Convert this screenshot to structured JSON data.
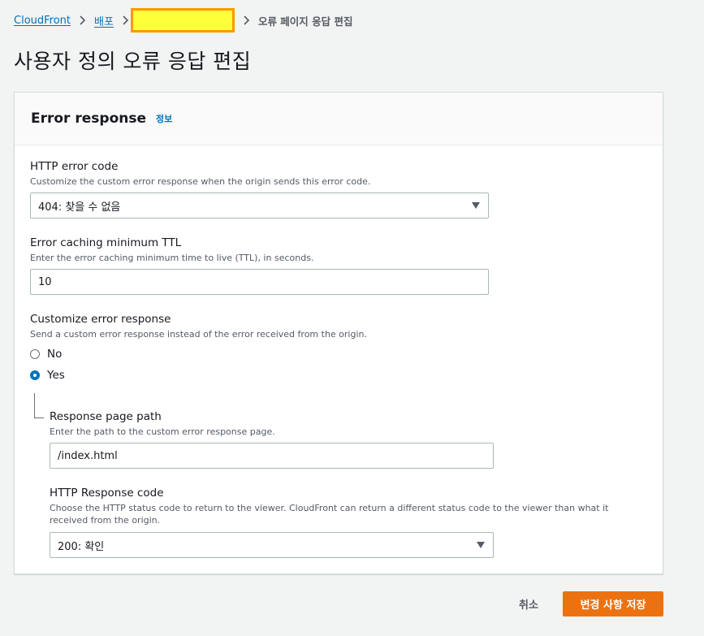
{
  "breadcrumb": {
    "items": [
      "CloudFront",
      "배포"
    ],
    "current": "오류 페이지 응답 편집"
  },
  "page": {
    "title": "사용자 정의 오류 응답 편집"
  },
  "panel": {
    "title": "Error response",
    "info": "정보"
  },
  "fields": {
    "http_error_code": {
      "label": "HTTP error code",
      "description": "Customize the custom error response when the origin sends this error code.",
      "value": "404: 찾을 수 없음"
    },
    "ttl": {
      "label": "Error caching minimum TTL",
      "description": "Enter the error caching minimum time to live (TTL), in seconds.",
      "value": "10"
    },
    "customize": {
      "label": "Customize error response",
      "description": "Send a custom error response instead of the error received from the origin.",
      "options": [
        "No",
        "Yes"
      ],
      "selected": "Yes"
    },
    "response_page_path": {
      "label": "Response page path",
      "description": "Enter the path to the custom error response page.",
      "value": "/index.html"
    },
    "http_response_code": {
      "label": "HTTP Response code",
      "description": "Choose the HTTP status code to return to the viewer. CloudFront can return a different status code to the viewer than what it received from the origin.",
      "value": "200: 확인"
    }
  },
  "actions": {
    "cancel": "취소",
    "save": "변경 사항 저장"
  },
  "colors": {
    "accent": "#0073bb",
    "primary_button": "#ec7211",
    "highlight": "#ffff3a",
    "highlight_border": "#ff9900"
  },
  "icons": {
    "separator": "chevron-right-icon",
    "select": "caret-down-icon"
  }
}
